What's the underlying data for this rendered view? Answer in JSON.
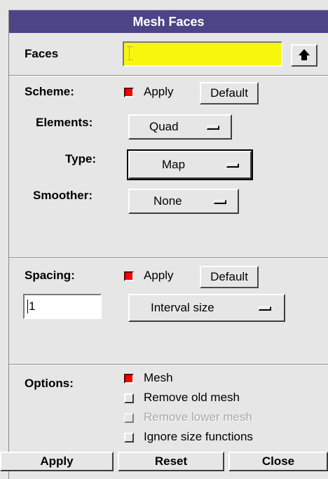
{
  "window": {
    "title": "Mesh Faces"
  },
  "faces": {
    "label": "Faces",
    "value": ""
  },
  "scheme": {
    "label": "Scheme:",
    "apply_label": "Apply",
    "apply_checked": true,
    "default_label": "Default",
    "elements": {
      "label": "Elements:",
      "value": "Quad"
    },
    "type": {
      "label": "Type:",
      "value": "Map"
    },
    "smoother": {
      "label": "Smoother:",
      "value": "None"
    }
  },
  "spacing": {
    "label": "Spacing:",
    "apply_label": "Apply",
    "apply_checked": true,
    "default_label": "Default",
    "value": "1",
    "mode": "Interval size"
  },
  "options": {
    "label": "Options:",
    "items": [
      {
        "label": "Mesh",
        "checked": true,
        "enabled": true
      },
      {
        "label": "Remove old mesh",
        "checked": false,
        "enabled": true
      },
      {
        "label": "Remove lower mesh",
        "checked": false,
        "enabled": false
      },
      {
        "label": "Ignore size functions",
        "checked": false,
        "enabled": true
      }
    ]
  },
  "buttons": {
    "apply": "Apply",
    "reset": "Reset",
    "close": "Close"
  },
  "colors": {
    "title_bg": "#4b4587",
    "field_highlight": "#f7f70e",
    "checked": "#ff0000"
  }
}
